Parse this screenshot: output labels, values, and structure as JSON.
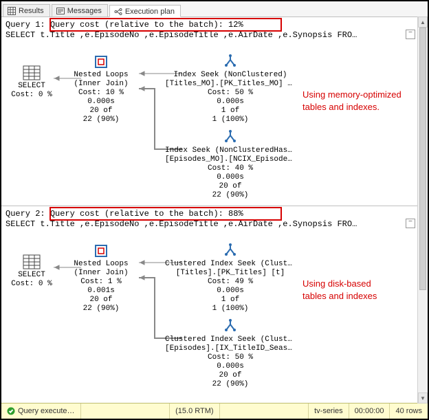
{
  "tabs": {
    "results": "Results",
    "messages": "Messages",
    "execution_plan": "Execution plan"
  },
  "queries": [
    {
      "prefix": "Query 1:",
      "cost_line": "Query cost (relative to the batch): 12%",
      "sql": "SELECT t.Title ,e.EpisodeNo ,e.EpisodeTitle ,e.AirDate ,e.Synopsis FRO…",
      "annotation": "Using memory-optimized\ntables and indexes.",
      "nodes": {
        "select_label": "SELECT",
        "select_cost": "Cost: 0 %",
        "nl_t": "Nested Loops",
        "nl_sub": "(Inner Join)",
        "nl_cost": "Cost: 10 %",
        "nl_time": "0.000s",
        "nl_rows": "20 of",
        "nl_rows2": "22 (90%)",
        "s1_t": "Index Seek (NonClustered)",
        "s1_obj": "[Titles_MO].[PK_Titles_MO] […",
        "s1_cost": "Cost: 50 %",
        "s1_time": "0.000s",
        "s1_rows": "1 of",
        "s1_rows2": "1 (100%)",
        "s2_t": "Index Seek (NonClusteredHash)",
        "s2_obj": "[Episodes_MO].[NCIX_Episodes…",
        "s2_cost": "Cost: 40 %",
        "s2_time": "0.000s",
        "s2_rows": "20 of",
        "s2_rows2": "22 (90%)"
      }
    },
    {
      "prefix": "Query 2:",
      "cost_line": "Query cost (relative to the batch): 88%",
      "sql": "SELECT t.Title ,e.EpisodeNo ,e.EpisodeTitle ,e.AirDate ,e.Synopsis FRO…",
      "annotation": "Using disk-based\ntables and indexes",
      "nodes": {
        "select_label": "SELECT",
        "select_cost": "Cost: 0 %",
        "nl_t": "Nested Loops",
        "nl_sub": "(Inner Join)",
        "nl_cost": "Cost: 1 %",
        "nl_time": "0.001s",
        "nl_rows": "20 of",
        "nl_rows2": "22 (90%)",
        "s1_t": "Clustered Index Seek (Cluste…",
        "s1_obj": "[Titles].[PK_Titles] [t]",
        "s1_cost": "Cost: 49 %",
        "s1_time": "0.000s",
        "s1_rows": "1 of",
        "s1_rows2": "1 (100%)",
        "s2_t": "Clustered Index Seek (Cluste…",
        "s2_obj": "[Episodes].[IX_TitleID_Seaso…",
        "s2_cost": "Cost: 50 %",
        "s2_time": "0.000s",
        "s2_rows": "20 of",
        "s2_rows2": "22 (90%)"
      }
    }
  ],
  "statusbar": {
    "state": "Query execute…",
    "version": "(15.0 RTM)",
    "db": "tv-series",
    "elapsed": "00:00:00",
    "rows": "40 rows"
  }
}
